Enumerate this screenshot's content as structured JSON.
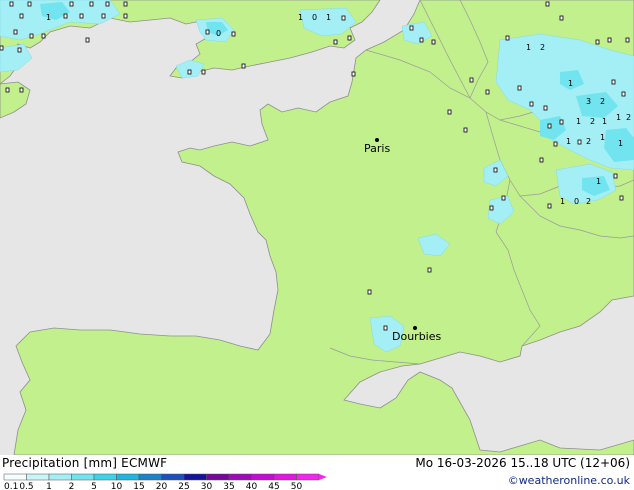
{
  "map": {
    "cities": [
      {
        "name": "Paris"
      },
      {
        "name": "Dourbies"
      }
    ],
    "value_labels": [
      "1",
      "1",
      "0",
      "1",
      "0",
      "1",
      "2",
      "3",
      "2",
      "1",
      "2",
      "1",
      "1",
      "1",
      "2",
      "1",
      "2",
      "1",
      "1",
      "0",
      "2",
      "1",
      "1"
    ]
  },
  "footer": {
    "title": "Precipitation [mm]  ECMWF",
    "datetime": "Mo 16-03-2026 15..18 UTC (12+06)",
    "credit": "©weatheronline.co.uk"
  },
  "legend": {
    "labels": [
      "0.1",
      "0.5",
      "1",
      "2",
      "5",
      "10",
      "15",
      "20",
      "25",
      "30",
      "35",
      "40",
      "45",
      "50"
    ],
    "colors": [
      "#f5fdfd",
      "#c8f5f8",
      "#a3eff5",
      "#72e4f0",
      "#3cd2ea",
      "#1fb5e0",
      "#1b82c8",
      "#1c4fb8",
      "#14149a",
      "#78059c",
      "#a00bb8",
      "#c20ed2",
      "#e216e0",
      "#f425ec"
    ]
  }
}
